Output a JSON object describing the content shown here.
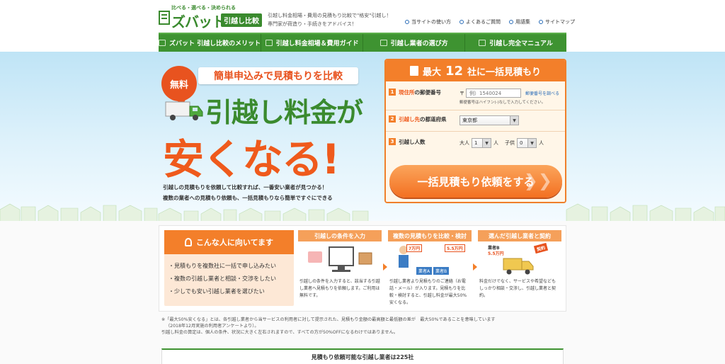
{
  "header": {
    "logo_small": "比べる・選べる・決められる",
    "logo_main": "ズバット",
    "logo_badge": "引越し比較",
    "tagline_1": "引越し料金相場・費用の見積もり比較で\"格安\"引越し！",
    "tagline_2": "専門家が荷造り・手続きをアドバイス！",
    "util_nav": [
      "当サイトの使い方",
      "よくあるご質問",
      "用語集",
      "サイトマップ"
    ]
  },
  "main_nav": {
    "items": [
      "ズバット 引越し比較のメリット",
      "引越し料金相場＆費用ガイド",
      "引越し業者の選び方",
      "引越し完全マニュアル"
    ]
  },
  "hero": {
    "free_badge": "無料",
    "catch": "簡単申込みで見積もりを比較",
    "headline_1": "引越し料金が",
    "headline_2": "安くなる!",
    "desc_1": "引越しの見積もりを依頼して比較すれば、一番安い業者が見つかる！",
    "desc_2": "複数の業者への見積もり依頼も、一括見積もりなら簡単ですぐにできる"
  },
  "form": {
    "header_pre": "最大",
    "header_num": "12",
    "header_post": "社に一括見積もり",
    "row1": {
      "num": "1",
      "label_hl": "現住所",
      "label_rest": "の郵便番号",
      "zip_mark": "〒",
      "zip_placeholder": "例）1540024",
      "zip_link": "郵便番号を調べる",
      "zip_note": "郵便番号はハイフン(-)なしで入力してください。"
    },
    "row2": {
      "num": "2",
      "label_hl": "引越し先",
      "label_rest": "の都道府県",
      "selected": "東京都",
      "arrow": "▼"
    },
    "row3": {
      "num": "3",
      "label": "引越し人数",
      "adult_label": "大人",
      "adult_value": "1",
      "child_label": "子供",
      "child_value": "0",
      "unit": "人",
      "arrow": "▼"
    },
    "cta": "一括見積もり依頼をする",
    "cta_arrows": "❯❯"
  },
  "recommend": {
    "title": "こんな人に向いてます",
    "items": [
      "・見積もりを複数社に一括で申し込みたい",
      "・複数の引越し業者と相談・交渉をしたい",
      "・少しでも安い引越し業者を選びたい"
    ]
  },
  "steps": [
    {
      "title": "引越しの条件を入力",
      "text": "引越しの条件を入力すると、該当する引越し業者へ見積もりを依頼します。ご利用は無料です。"
    },
    {
      "title": "複数の見積もりを比較・検討",
      "text": "引越し業者より見積もりのご連絡（お電話・メール）が入ります。見積もりを比較・検討すると、引越し料金が最大50%安くなる。",
      "price_a": "7万円",
      "price_b": "5.5万円",
      "company_a": "業者A",
      "company_b": "業者B"
    },
    {
      "title": "選んだ引越し業者と契約",
      "text": "料金だけでなく、サービスや希望なども しっかり相談・交渉し、引越し業者と契約。",
      "company": "業者B",
      "price": "5.5万円",
      "tag": "契約"
    }
  ],
  "footnote": {
    "line1": "※「最大50%安くなる」とは、各引越し業者から当サービスの利用者に対して提示された、見積もり金額の最高額と最低額の差が　最大50%であることを意味しています",
    "line2": "（2018年12月実施の利用者アンケートより）。",
    "line3": "引越し料金の算定は、個人の条件、状況に大きく左右されますので、すべての方が50%OFFになるわけではありません。"
  },
  "count_bar": "見積もり依頼可能な引越し業者は225社",
  "colors": {
    "green": "#3e9331",
    "orange": "#f37f2a",
    "red_orange": "#ef5a1c"
  }
}
